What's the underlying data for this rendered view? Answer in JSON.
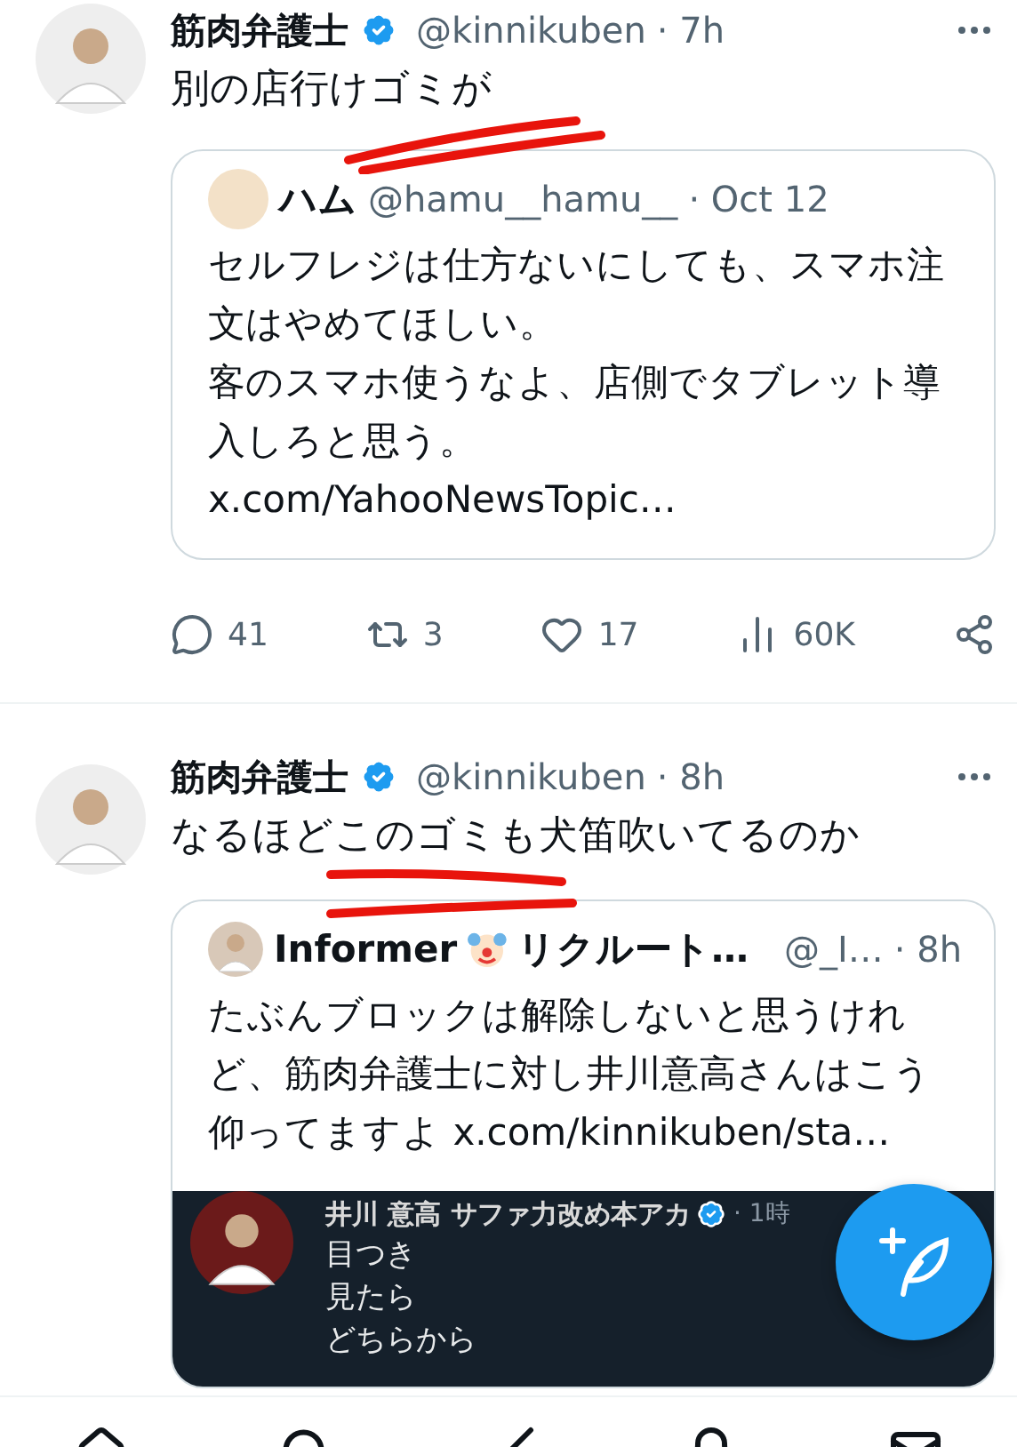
{
  "tweets": [
    {
      "author": {
        "name": "筋肉弁護士",
        "verified": true,
        "handle": "@kinnikuben",
        "time": "· 7h"
      },
      "text": "別の店行けゴミが",
      "scribble": true,
      "quote": {
        "author": {
          "name": "ハム",
          "handle": "@hamu__hamu__",
          "time": "· Oct 12"
        },
        "lines": [
          "セルフレジは仕方ないにしても、スマホ注文はやめてほしい。",
          "客のスマホ使うなよ、店側でタブレット導入しろと思う。"
        ],
        "link": "x.com/YahooNewsTopic…"
      },
      "actions": [
        {
          "kind": "reply",
          "count": "41"
        },
        {
          "kind": "repost",
          "count": "3"
        },
        {
          "kind": "like",
          "count": "17"
        },
        {
          "kind": "views",
          "count": "60K"
        },
        {
          "kind": "share"
        }
      ]
    },
    {
      "author": {
        "name": "筋肉弁護士",
        "verified": true,
        "handle": "@kinnikuben",
        "time": "· 8h"
      },
      "text": "なるほどこのゴミも犬笛吹いてるのか",
      "scribble": true,
      "quote": {
        "author": {
          "name": "Informer",
          "name_suffix": "リクルート…",
          "emoji": true,
          "handle": "@_I…",
          "time": "· 8h"
        },
        "text": "たぶんブロックは解除しないと思うけれど、筋肉弁護士に対し井川意高さんはこう仰ってますよ ",
        "link": "x.com/kinnikuben/sta…",
        "media": {
          "kind": "screenshot",
          "name": "井川 意高 サファ力改め本アカ",
          "verified": true,
          "time": "· 1時",
          "lines": [
            "目つき",
            "見たら",
            "どちらから"
          ]
        }
      }
    }
  ],
  "nav": [
    {
      "kind": "home"
    },
    {
      "kind": "search"
    },
    {
      "kind": "grok"
    },
    {
      "kind": "bell"
    },
    {
      "kind": "mail"
    }
  ]
}
